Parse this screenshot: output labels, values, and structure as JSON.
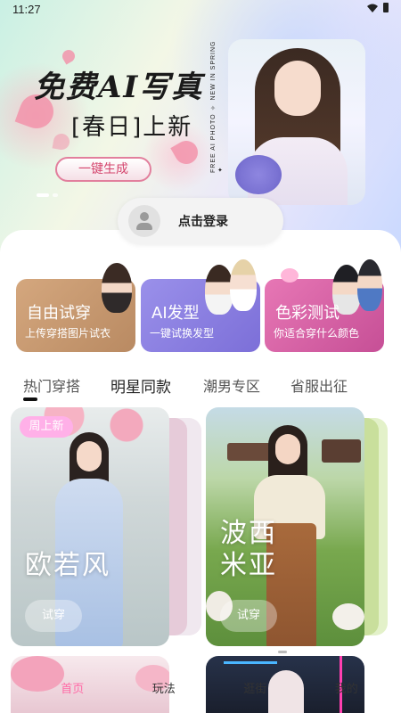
{
  "status_bar": {
    "time": "11:27"
  },
  "hero": {
    "title": "免费AI写真",
    "subtitle": "[春日]上新",
    "button_label": "一键生成",
    "vertical_caption": "FREE AI PHOTO ✧ NEW IN SPRING ✦"
  },
  "login": {
    "label": "点击登录"
  },
  "features": [
    {
      "title": "自由试穿",
      "desc": "上传穿搭图片试衣"
    },
    {
      "title": "AI发型",
      "desc": "一键试换发型"
    },
    {
      "title": "色彩测试",
      "desc": "你适合穿什么颜色"
    }
  ],
  "tabs": [
    {
      "label": "热门穿搭"
    },
    {
      "label": "明星同款"
    },
    {
      "label": "潮男专区"
    },
    {
      "label": "省服出征"
    }
  ],
  "outfits": [
    {
      "badge": "周上新",
      "name_line1": "欧若风",
      "name_line2": "",
      "try_label": "试穿"
    },
    {
      "badge": "",
      "name_line1": "波西",
      "name_line2": "米亚",
      "try_label": "试穿"
    }
  ],
  "bottom_nav": [
    {
      "label": "首页"
    },
    {
      "label": "玩法"
    },
    {
      "label": "逛街"
    },
    {
      "label": "我的"
    }
  ],
  "colors": {
    "accent_pink": "#ff6aa6",
    "hero_button_border": "#e27f9d",
    "feature_1": "#c99a70",
    "feature_2": "#8a7fe0",
    "feature_3": "#d864a6"
  }
}
